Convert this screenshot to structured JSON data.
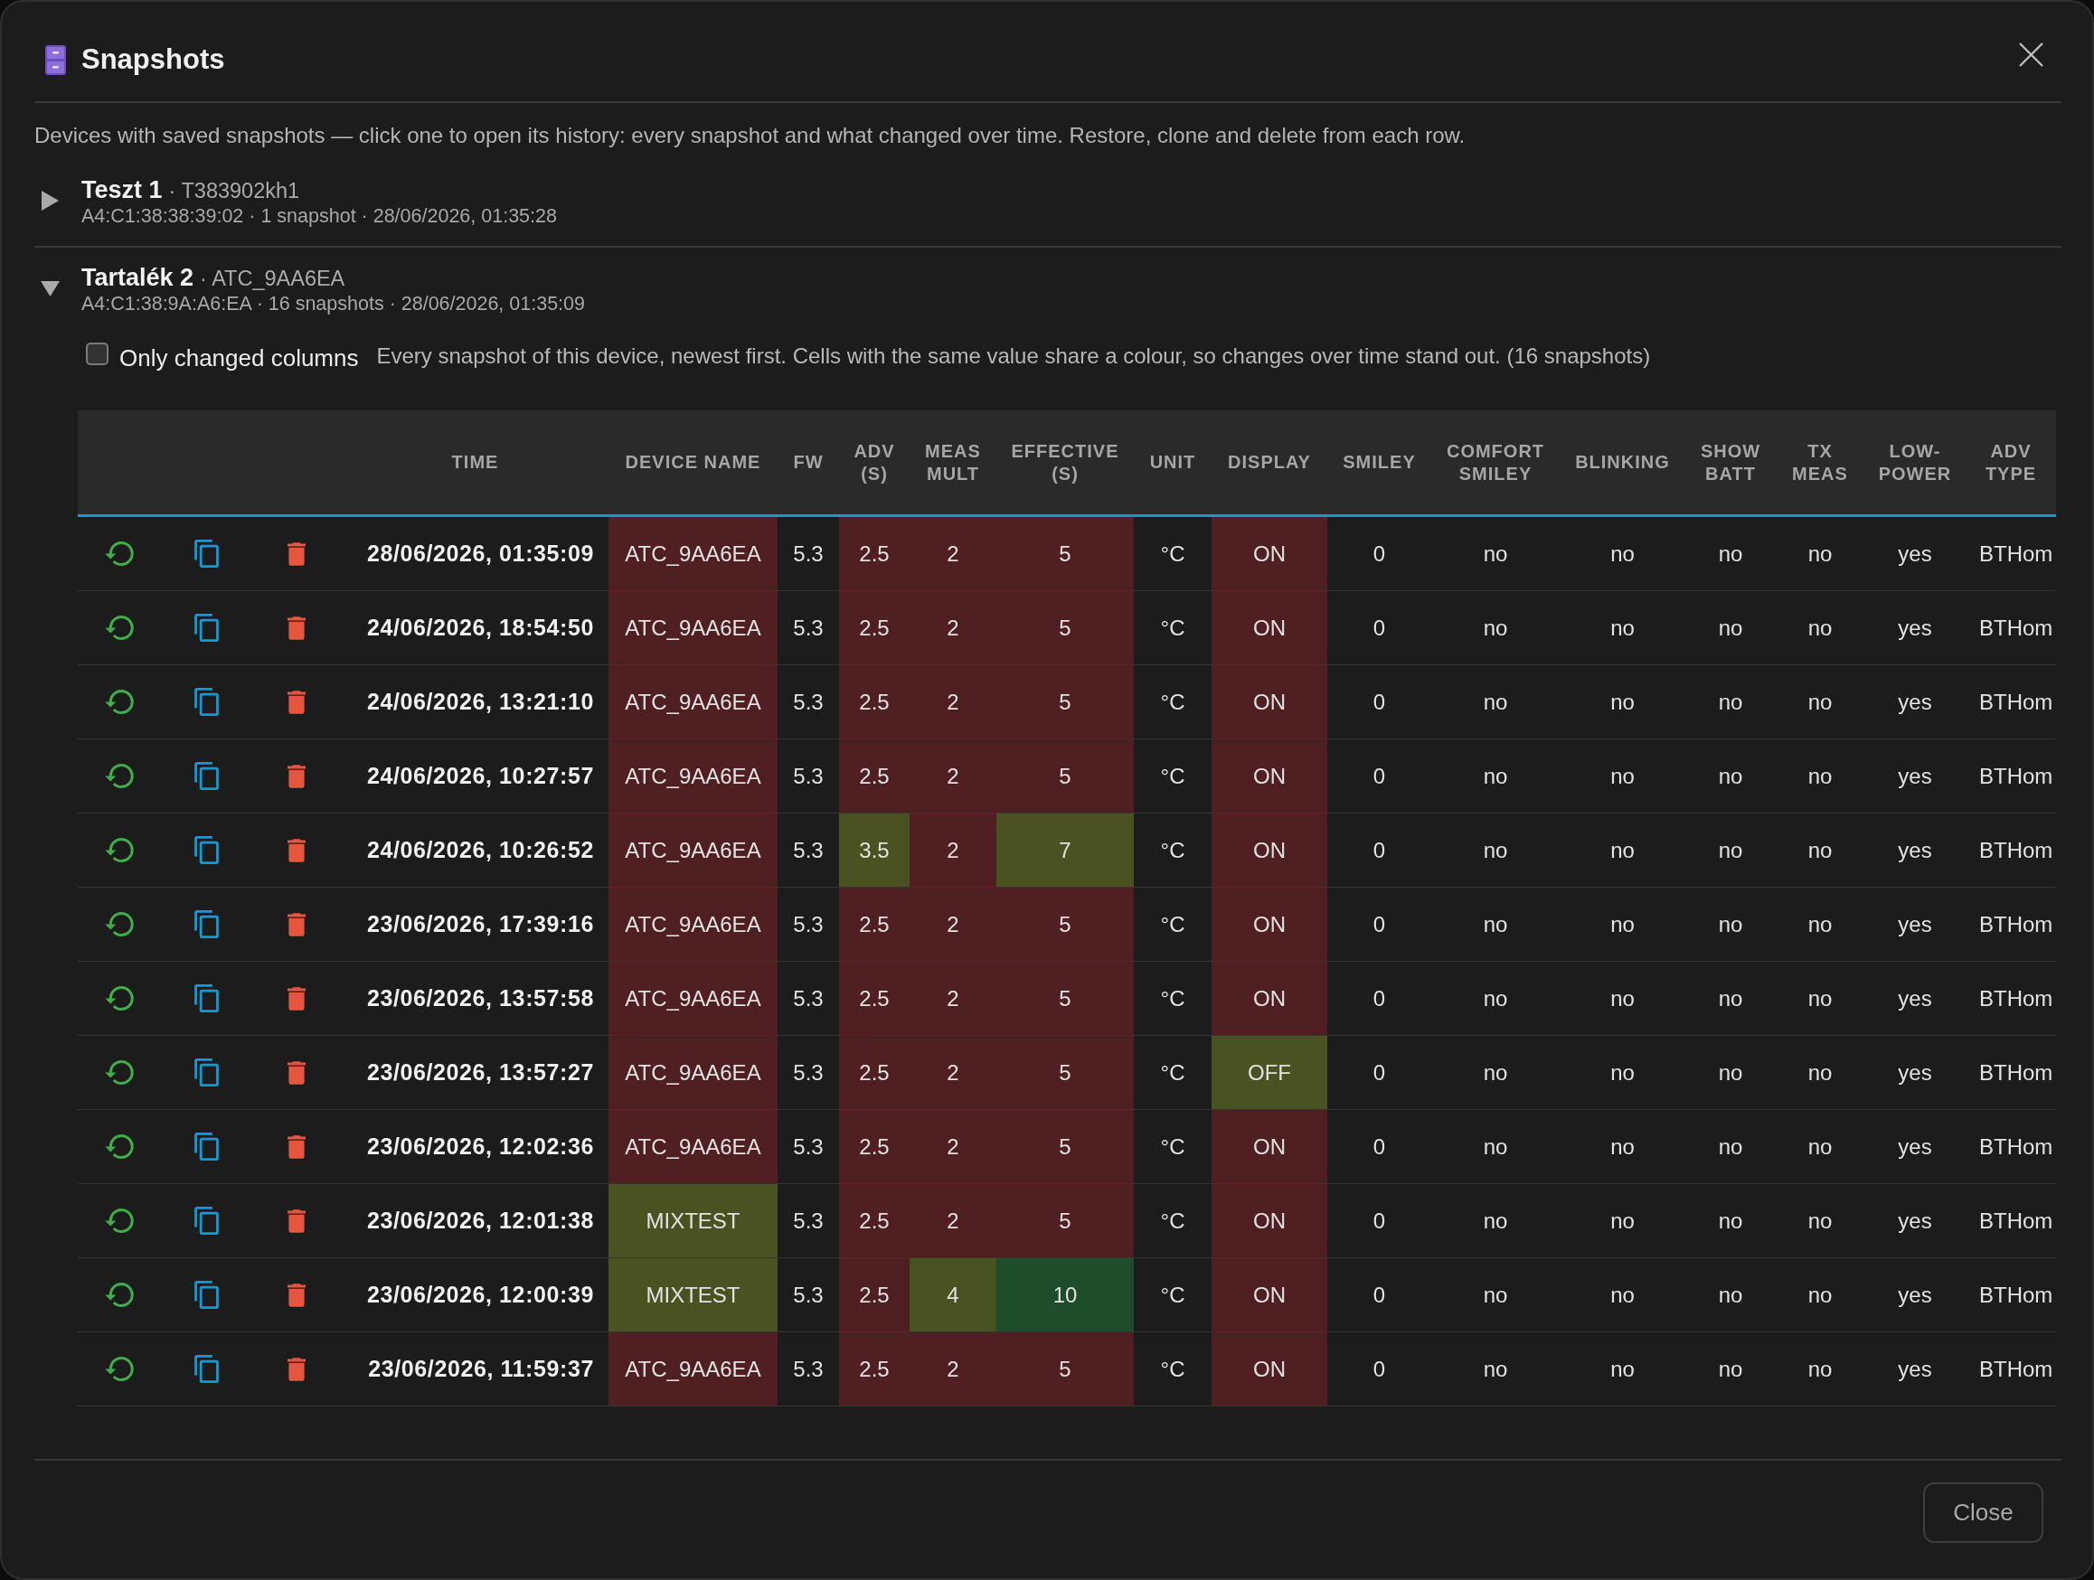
{
  "dialog": {
    "title": "Snapshots",
    "description": "Devices with saved snapshots — click one to open its history: every snapshot and what changed over time. Restore, clone and delete from each row.",
    "devices": [
      {
        "name": "Teszt 1",
        "subtitle": "· T383902kh1",
        "meta": "A4:C1:38:38:39:02 · 1 snapshot · 28/06/2026, 01:35:28",
        "expanded": false
      },
      {
        "name": "Tartalék 2",
        "subtitle": "· ATC_9AA6EA",
        "meta": "A4:C1:38:9A:A6:EA · 16 snapshots · 28/06/2026, 01:35:09",
        "expanded": true,
        "history": {
          "filter": {
            "label": "Only changed columns",
            "checked": false
          },
          "note": "Every snapshot of this device, newest first. Cells with the same value share a colour, so changes over time stand out. (16 snapshots)",
          "table": {
            "columns": [
              "TIME",
              "DEVICE NAME",
              "FW",
              "ADV (S)",
              "MEAS MULT",
              "EFFECTIVE (S)",
              "UNIT",
              "DISPLAY",
              "SMILEY",
              "COMFORT SMILEY",
              "BLINKING",
              "SHOW BATT",
              "TX MEAS",
              "LOW-POWER",
              "ADV TYPE"
            ],
            "rows": [
              {
                "cells": [
                  "28/06/2026, 01:35:09",
                  {
                    "text": "ATC_9AA6EA",
                    "color": "#501f22"
                  },
                  "5.3",
                  {
                    "text": "2.5",
                    "color": "#501f22"
                  },
                  {
                    "text": "2",
                    "color": "#501f22"
                  },
                  {
                    "text": "5",
                    "color": "#501f22"
                  },
                  "°C",
                  {
                    "text": "ON",
                    "color": "#501f22"
                  },
                  "0",
                  "no",
                  "no",
                  "no",
                  "no",
                  "yes",
                  "BTHom"
                ]
              },
              {
                "cells": [
                  "24/06/2026, 18:54:50",
                  {
                    "text": "ATC_9AA6EA",
                    "color": "#501f22"
                  },
                  "5.3",
                  {
                    "text": "2.5",
                    "color": "#501f22"
                  },
                  {
                    "text": "2",
                    "color": "#501f22"
                  },
                  {
                    "text": "5",
                    "color": "#501f22"
                  },
                  "°C",
                  {
                    "text": "ON",
                    "color": "#501f22"
                  },
                  "0",
                  "no",
                  "no",
                  "no",
                  "no",
                  "yes",
                  "BTHom"
                ]
              },
              {
                "cells": [
                  "24/06/2026, 13:21:10",
                  {
                    "text": "ATC_9AA6EA",
                    "color": "#501f22"
                  },
                  "5.3",
                  {
                    "text": "2.5",
                    "color": "#501f22"
                  },
                  {
                    "text": "2",
                    "color": "#501f22"
                  },
                  {
                    "text": "5",
                    "color": "#501f22"
                  },
                  "°C",
                  {
                    "text": "ON",
                    "color": "#501f22"
                  },
                  "0",
                  "no",
                  "no",
                  "no",
                  "no",
                  "yes",
                  "BTHom"
                ]
              },
              {
                "cells": [
                  "24/06/2026, 10:27:57",
                  {
                    "text": "ATC_9AA6EA",
                    "color": "#501f22"
                  },
                  "5.3",
                  {
                    "text": "2.5",
                    "color": "#501f22"
                  },
                  {
                    "text": "2",
                    "color": "#501f22"
                  },
                  {
                    "text": "5",
                    "color": "#501f22"
                  },
                  "°C",
                  {
                    "text": "ON",
                    "color": "#501f22"
                  },
                  "0",
                  "no",
                  "no",
                  "no",
                  "no",
                  "yes",
                  "BTHom"
                ]
              },
              {
                "cells": [
                  "24/06/2026, 10:26:52",
                  {
                    "text": "ATC_9AA6EA",
                    "color": "#501f22"
                  },
                  "5.3",
                  {
                    "text": "3.5",
                    "color": "#4b5222"
                  },
                  {
                    "text": "2",
                    "color": "#501f22"
                  },
                  {
                    "text": "7",
                    "color": "#4b5222"
                  },
                  "°C",
                  {
                    "text": "ON",
                    "color": "#501f22"
                  },
                  "0",
                  "no",
                  "no",
                  "no",
                  "no",
                  "yes",
                  "BTHom"
                ]
              },
              {
                "cells": [
                  "23/06/2026, 17:39:16",
                  {
                    "text": "ATC_9AA6EA",
                    "color": "#501f22"
                  },
                  "5.3",
                  {
                    "text": "2.5",
                    "color": "#501f22"
                  },
                  {
                    "text": "2",
                    "color": "#501f22"
                  },
                  {
                    "text": "5",
                    "color": "#501f22"
                  },
                  "°C",
                  {
                    "text": "ON",
                    "color": "#501f22"
                  },
                  "0",
                  "no",
                  "no",
                  "no",
                  "no",
                  "yes",
                  "BTHom"
                ]
              },
              {
                "cells": [
                  "23/06/2026, 13:57:58",
                  {
                    "text": "ATC_9AA6EA",
                    "color": "#501f22"
                  },
                  "5.3",
                  {
                    "text": "2.5",
                    "color": "#501f22"
                  },
                  {
                    "text": "2",
                    "color": "#501f22"
                  },
                  {
                    "text": "5",
                    "color": "#501f22"
                  },
                  "°C",
                  {
                    "text": "ON",
                    "color": "#501f22"
                  },
                  "0",
                  "no",
                  "no",
                  "no",
                  "no",
                  "yes",
                  "BTHom"
                ]
              },
              {
                "cells": [
                  "23/06/2026, 13:57:27",
                  {
                    "text": "ATC_9AA6EA",
                    "color": "#501f22"
                  },
                  "5.3",
                  {
                    "text": "2.5",
                    "color": "#501f22"
                  },
                  {
                    "text": "2",
                    "color": "#501f22"
                  },
                  {
                    "text": "5",
                    "color": "#501f22"
                  },
                  "°C",
                  {
                    "text": "OFF",
                    "color": "#4b5222"
                  },
                  "0",
                  "no",
                  "no",
                  "no",
                  "no",
                  "yes",
                  "BTHom"
                ]
              },
              {
                "cells": [
                  "23/06/2026, 12:02:36",
                  {
                    "text": "ATC_9AA6EA",
                    "color": "#501f22"
                  },
                  "5.3",
                  {
                    "text": "2.5",
                    "color": "#501f22"
                  },
                  {
                    "text": "2",
                    "color": "#501f22"
                  },
                  {
                    "text": "5",
                    "color": "#501f22"
                  },
                  "°C",
                  {
                    "text": "ON",
                    "color": "#501f22"
                  },
                  "0",
                  "no",
                  "no",
                  "no",
                  "no",
                  "yes",
                  "BTHom"
                ]
              },
              {
                "cells": [
                  "23/06/2026, 12:01:38",
                  {
                    "text": "MIXTEST",
                    "color": "#4b5222"
                  },
                  "5.3",
                  {
                    "text": "2.5",
                    "color": "#501f22"
                  },
                  {
                    "text": "2",
                    "color": "#501f22"
                  },
                  {
                    "text": "5",
                    "color": "#501f22"
                  },
                  "°C",
                  {
                    "text": "ON",
                    "color": "#501f22"
                  },
                  "0",
                  "no",
                  "no",
                  "no",
                  "no",
                  "yes",
                  "BTHom"
                ]
              },
              {
                "cells": [
                  "23/06/2026, 12:00:39",
                  {
                    "text": "MIXTEST",
                    "color": "#4b5222"
                  },
                  "5.3",
                  {
                    "text": "2.5",
                    "color": "#501f22"
                  },
                  {
                    "text": "4",
                    "color": "#4b5222"
                  },
                  {
                    "text": "10",
                    "color": "#1f4d2b"
                  },
                  "°C",
                  {
                    "text": "ON",
                    "color": "#501f22"
                  },
                  "0",
                  "no",
                  "no",
                  "no",
                  "no",
                  "yes",
                  "BTHom"
                ]
              },
              {
                "cells": [
                  "23/06/2026, 11:59:37",
                  {
                    "text": "ATC_9AA6EA",
                    "color": "#501f22"
                  },
                  "5.3",
                  {
                    "text": "2.5",
                    "color": "#501f22"
                  },
                  {
                    "text": "2",
                    "color": "#501f22"
                  },
                  {
                    "text": "5",
                    "color": "#501f22"
                  },
                  "°C",
                  {
                    "text": "ON",
                    "color": "#501f22"
                  },
                  "0",
                  "no",
                  "no",
                  "no",
                  "no",
                  "yes",
                  "BTHom"
                ]
              }
            ]
          }
        }
      }
    ],
    "footer_buttons": [
      "Close"
    ]
  }
}
